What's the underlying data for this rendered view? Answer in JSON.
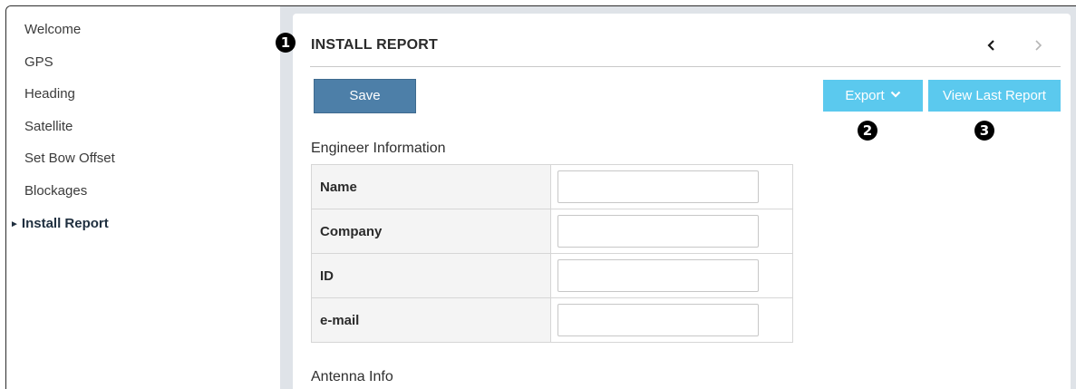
{
  "sidebar": {
    "items": [
      {
        "label": "Welcome"
      },
      {
        "label": "GPS"
      },
      {
        "label": "Heading"
      },
      {
        "label": "Satellite"
      },
      {
        "label": "Set Bow Offset"
      },
      {
        "label": "Blockages"
      },
      {
        "label": "Install Report",
        "active": true
      }
    ]
  },
  "markers": [
    "1",
    "2",
    "3"
  ],
  "header": {
    "title": "INSTALL REPORT",
    "prev_icon": "chevron-left-icon",
    "next_icon": "chevron-right-icon"
  },
  "toolbar": {
    "save_label": "Save",
    "export_label": "Export",
    "export_icon": "chevron-down-icon",
    "view_last_label": "View Last Report"
  },
  "engineer": {
    "section_title": "Engineer Information",
    "fields": [
      {
        "label": "Name",
        "value": ""
      },
      {
        "label": "Company",
        "value": ""
      },
      {
        "label": "ID",
        "value": ""
      },
      {
        "label": "e-mail",
        "value": ""
      }
    ]
  },
  "antenna": {
    "section_title": "Antenna Info"
  },
  "colors": {
    "accent_button": "#5bc9ee",
    "save_button": "#4d7fa8",
    "frame_background": "#dfe3e8"
  }
}
